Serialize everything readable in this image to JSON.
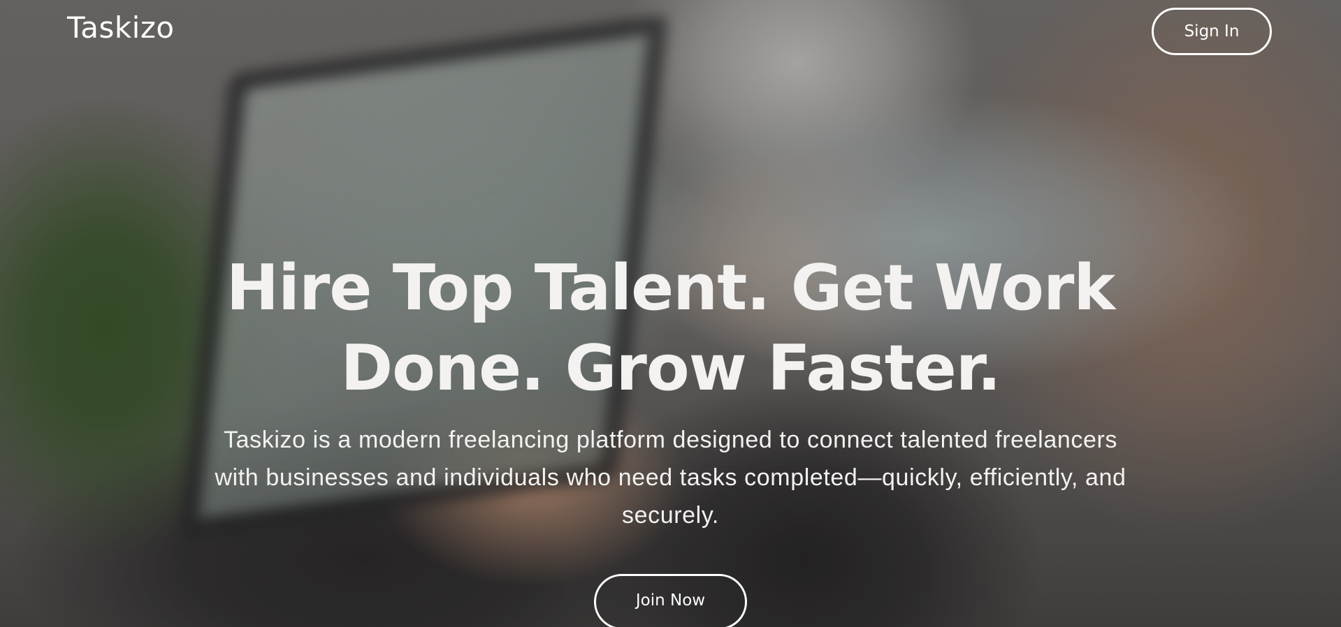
{
  "navbar": {
    "logo_text": "Taskizo",
    "signin_label": "Sign In"
  },
  "hero": {
    "headline_line1": "Hire Top Talent. Get Work",
    "headline_line2": "Done. Grow Faster.",
    "subtext_line1": "Taskizo is a modern freelancing platform designed to connect talented freelancers",
    "subtext_line2": "with businesses and individuals who need tasks completed—quickly, efficiently, and",
    "subtext_line3": "securely.",
    "cta_label": "Join Now"
  },
  "colors": {
    "text": "#f3f2f1",
    "button_border": "#ffffff"
  }
}
